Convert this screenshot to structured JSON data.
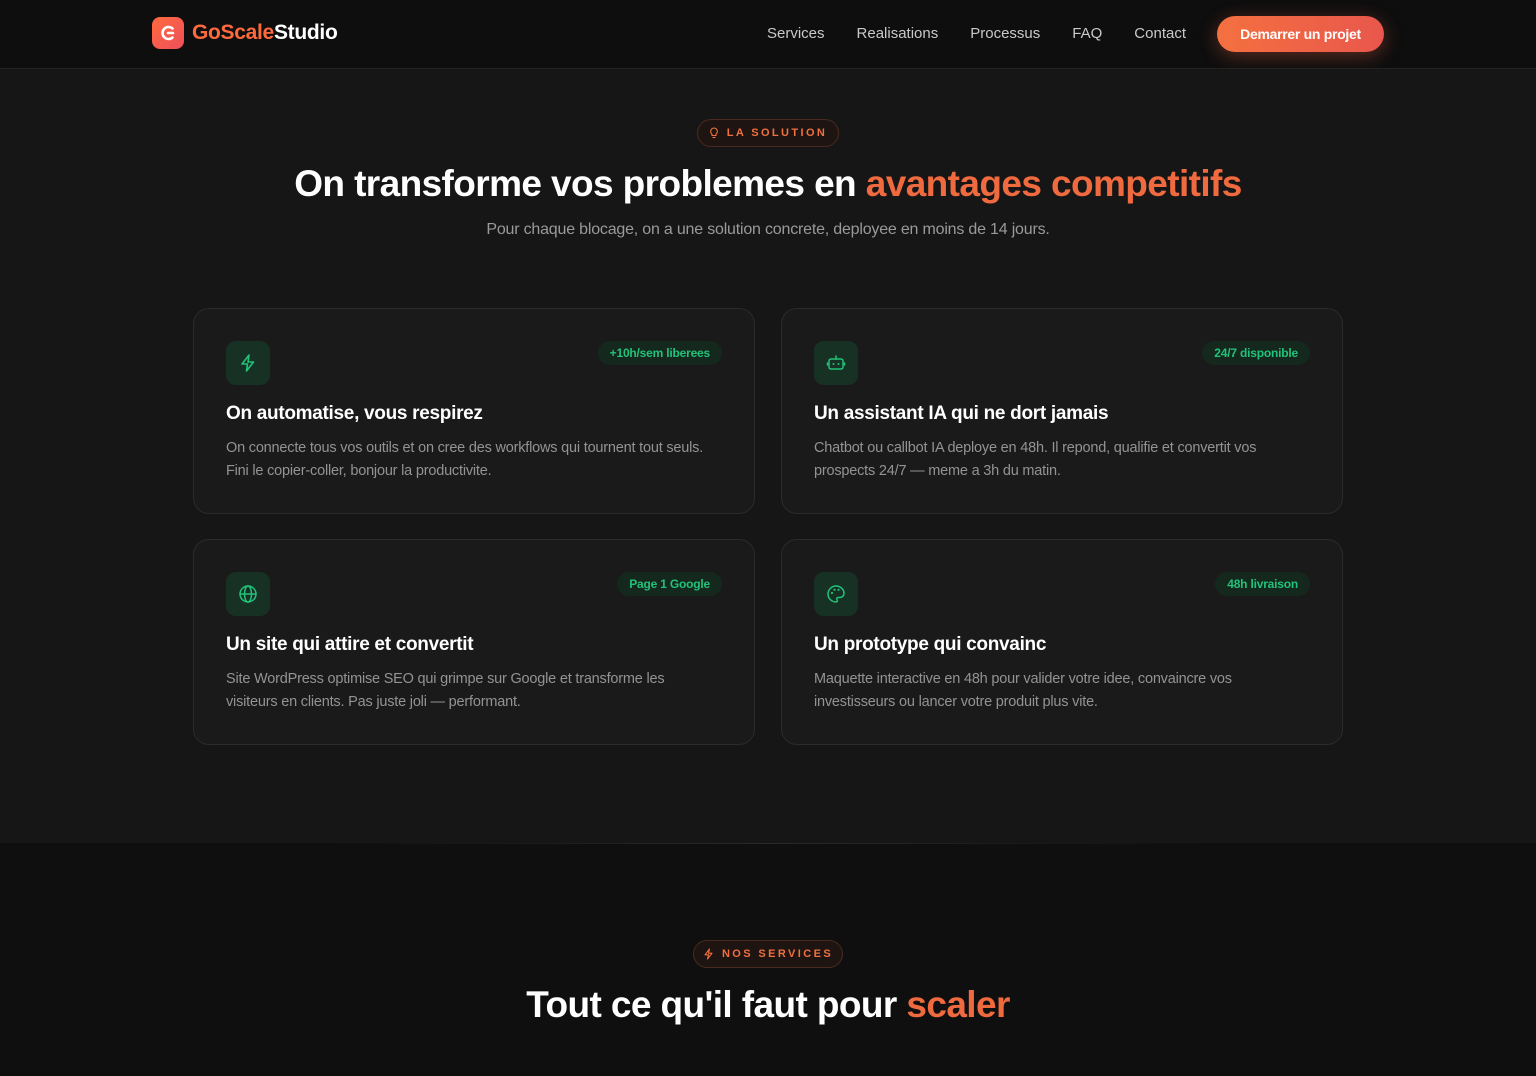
{
  "nav": {
    "brand_part1": "GoScale",
    "brand_part2": "Studio",
    "links": [
      "Services",
      "Realisations",
      "Processus",
      "FAQ",
      "Contact"
    ],
    "cta_label": "Demarrer un projet"
  },
  "solution": {
    "pill_label": "LA SOLUTION",
    "title_main": "On transforme vos problemes en ",
    "title_accent": "avantages competitifs",
    "subtitle": "Pour chaque blocage, on a une solution concrete, deployee en moins de 14 jours.",
    "cards": [
      {
        "icon": "lightning-icon",
        "badge": "+10h/sem liberees",
        "title": "On automatise, vous respirez",
        "desc": "On connecte tous vos outils et on cree des workflows qui tournent tout seuls. Fini le copier-coller, bonjour la productivite."
      },
      {
        "icon": "bot-icon",
        "badge": "24/7 disponible",
        "title": "Un assistant IA qui ne dort jamais",
        "desc": "Chatbot ou callbot IA deploye en 48h. Il repond, qualifie et convertit vos prospects 24/7 — meme a 3h du matin."
      },
      {
        "icon": "globe-icon",
        "badge": "Page 1 Google",
        "title": "Un site qui attire et convertit",
        "desc": "Site WordPress optimise SEO qui grimpe sur Google et transforme les visiteurs en clients. Pas juste joli — performant."
      },
      {
        "icon": "palette-icon",
        "badge": "48h livraison",
        "title": "Un prototype qui convainc",
        "desc": "Maquette interactive en 48h pour valider votre idee, convaincre vos investisseurs ou lancer votre produit plus vite."
      }
    ]
  },
  "services": {
    "pill_label": "NOS SERVICES",
    "title_main": "Tout ce qu'il faut pour ",
    "title_accent": "scaler"
  },
  "colors": {
    "accent": "#f06a3f",
    "badge_green": "#22c27a",
    "background": "#161616"
  }
}
